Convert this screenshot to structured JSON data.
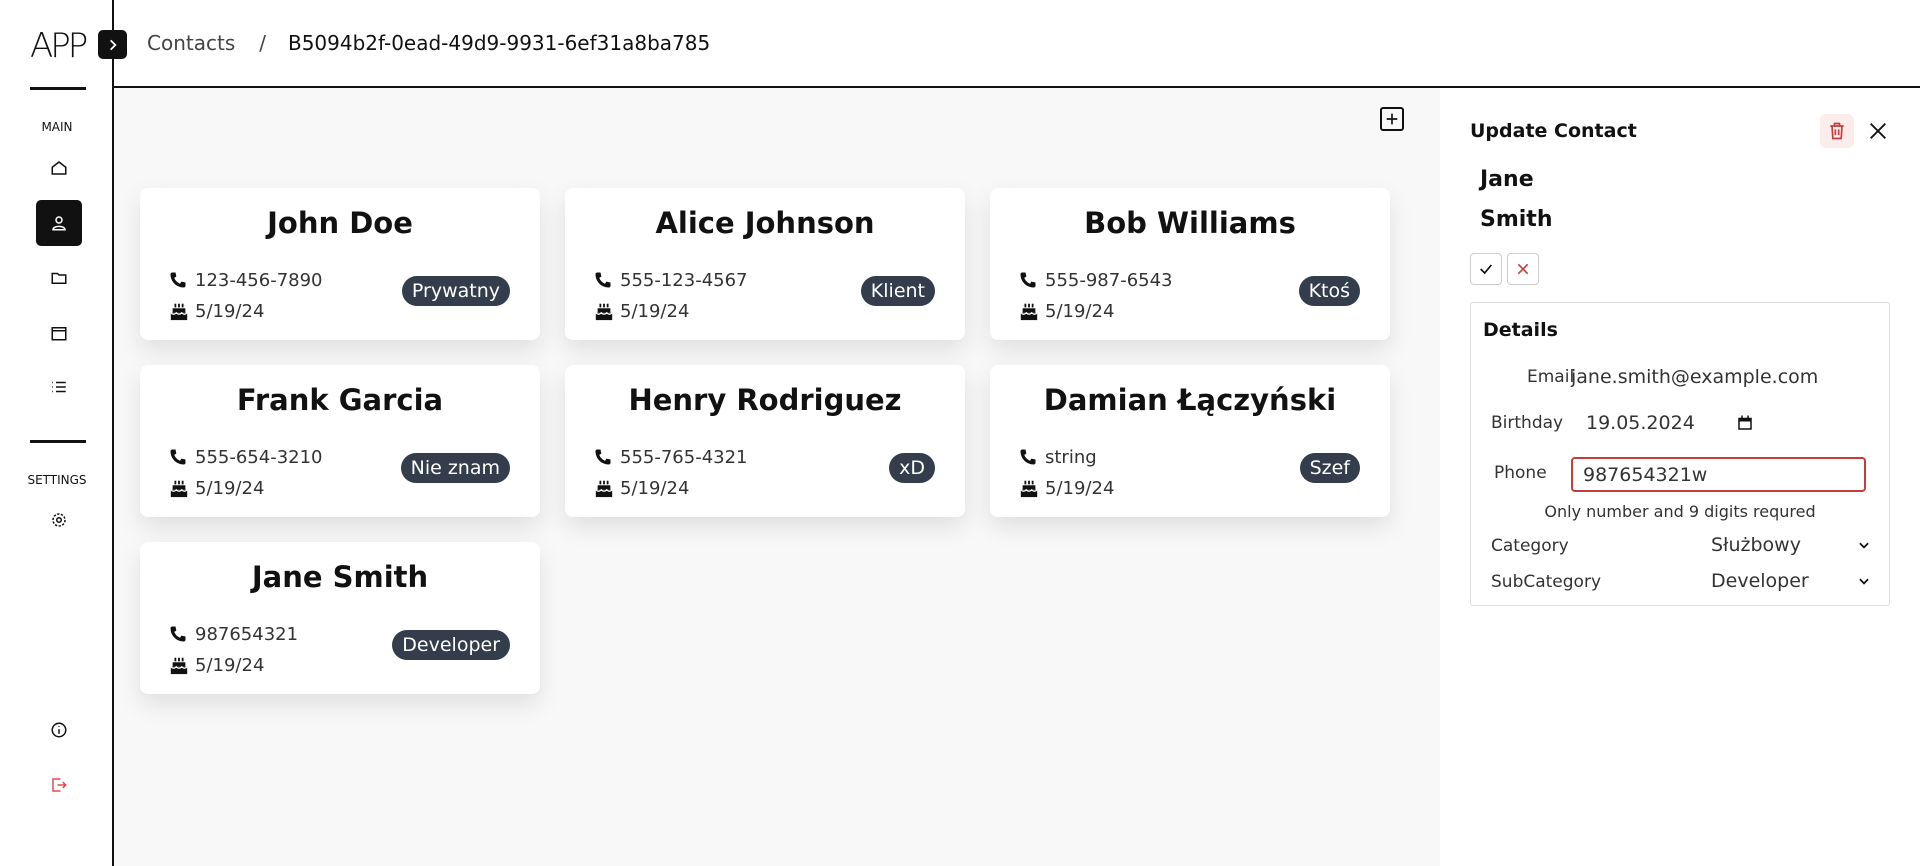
{
  "app": {
    "logo": "APP"
  },
  "sidebar": {
    "main_label": "MAIN",
    "settings_label": "SETTINGS",
    "items": [
      {
        "icon": "home-icon"
      },
      {
        "icon": "user-icon",
        "active": true
      },
      {
        "icon": "folder-icon"
      },
      {
        "icon": "calendar-icon"
      },
      {
        "icon": "list-icon"
      }
    ],
    "settings_items": [
      {
        "icon": "gear-icon"
      }
    ],
    "bottom_items": [
      {
        "icon": "info-icon"
      },
      {
        "icon": "logout-icon",
        "color": "#e5484d"
      }
    ]
  },
  "breadcrumb": {
    "parent": "Contacts",
    "separator": "/",
    "current": "B5094b2f-0ead-49d9-9931-6ef31a8ba785"
  },
  "contacts": [
    {
      "name": "John Doe",
      "phone": "123-456-7890",
      "birthday": "5/19/24",
      "category": "Prywatny"
    },
    {
      "name": "Alice Johnson",
      "phone": "555-123-4567",
      "birthday": "5/19/24",
      "category": "Klient"
    },
    {
      "name": "Bob Williams",
      "phone": "555-987-6543",
      "birthday": "5/19/24",
      "category": "Ktoś"
    },
    {
      "name": "Frank Garcia",
      "phone": "555-654-3210",
      "birthday": "5/19/24",
      "category": "Nie znam"
    },
    {
      "name": "Henry Rodriguez",
      "phone": "555-765-4321",
      "birthday": "5/19/24",
      "category": "xD"
    },
    {
      "name": "Damian Łączyński",
      "phone": "string",
      "birthday": "5/19/24",
      "category": "Szef"
    },
    {
      "name": "Jane Smith",
      "phone": "987654321",
      "birthday": "5/19/24",
      "category": "Developer"
    }
  ],
  "panel": {
    "title": "Update Contact",
    "first_name": "Jane",
    "last_name": "Smith",
    "details_title": "Details",
    "email_label": "Email",
    "email_value": "jane.smith@example.com",
    "birthday_label": "Birthday",
    "birthday_value": "19.05.2024",
    "phone_label": "Phone",
    "phone_value": "987654321w",
    "phone_error": "Only number and 9 digits requred",
    "category_label": "Category",
    "category_value": "Służbowy",
    "subcategory_label": "SubCategory",
    "subcategory_value": "Developer"
  },
  "colors": {
    "accent_dark": "#111111",
    "badge_bg": "#333d4b",
    "danger": "#c43c3c"
  }
}
